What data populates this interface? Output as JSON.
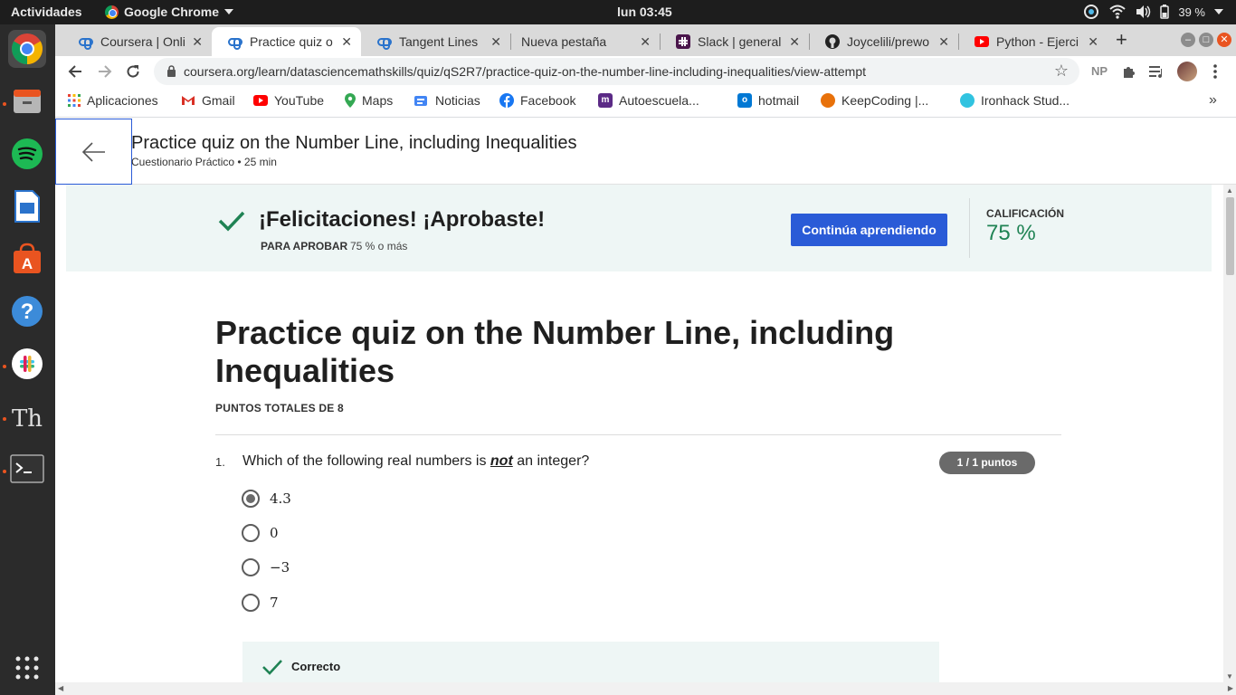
{
  "system": {
    "activities": "Actividades",
    "app_name": "Google Chrome",
    "clock": "lun 03:45",
    "battery": "39 %"
  },
  "tabs": [
    {
      "title": "Coursera | Onli",
      "active": false
    },
    {
      "title": "Practice quiz o",
      "active": true
    },
    {
      "title": "Tangent Lines",
      "active": false
    },
    {
      "title": "Nueva pestaña",
      "active": false
    },
    {
      "title": "Slack | general",
      "active": false
    },
    {
      "title": "Joycelili/prewo",
      "active": false
    },
    {
      "title": "Python - Ejerci",
      "active": false
    }
  ],
  "tab_close": "✕",
  "new_tab": "+",
  "address_bar": {
    "url": "coursera.org/learn/datasciencemathskills/quiz/qS2R7/practice-quiz-on-the-number-line-including-inequalities/view-attempt"
  },
  "profile_badge": "NP",
  "bookmarks": [
    {
      "label": "Aplicaciones",
      "color": "#ea4335"
    },
    {
      "label": "Gmail",
      "color": "#d93025"
    },
    {
      "label": "YouTube",
      "color": "#ff0000"
    },
    {
      "label": "Maps",
      "color": "#34a853"
    },
    {
      "label": "Noticias",
      "color": "#4285f4"
    },
    {
      "label": "Facebook",
      "color": "#1877f2"
    },
    {
      "label": "Autoescuela...",
      "color": "#5b2a86"
    },
    {
      "label": "hotmail",
      "color": "#0078d4"
    },
    {
      "label": "KeepCoding |...",
      "color": "#e8710a"
    },
    {
      "label": "Ironhack Stud...",
      "color": "#31c3e0"
    }
  ],
  "header": {
    "title": "Practice quiz on the Number Line, including Inequalities",
    "subtitle": "Cuestionario Práctico • 25 min"
  },
  "banner": {
    "congrats": "¡Felicitaciones! ¡Aprobaste!",
    "pass_label": "PARA APROBAR",
    "pass_value": "75 % o más",
    "continue_button": "Continúa aprendiendo",
    "grade_label": "CALIFICACIÓN",
    "grade_value": "75 %"
  },
  "quiz": {
    "title": "Practice quiz on the Number Line, including Inequalities",
    "total_points": "PUNTOS TOTALES DE 8",
    "question": {
      "number": "1.",
      "text_before": "Which of the following real numbers is ",
      "text_emph": "not",
      "text_after": " an integer?",
      "score": "1 / 1 puntos",
      "options": [
        {
          "label": "4.3",
          "checked": true
        },
        {
          "label": "0",
          "checked": false
        },
        {
          "label": "−3",
          "checked": false
        },
        {
          "label": "7",
          "checked": false
        }
      ],
      "feedback": "Correcto"
    }
  },
  "colors": {
    "brand_blue": "#2a5bd7",
    "success_green": "#1f8354",
    "banner_bg": "#eef6f5"
  }
}
